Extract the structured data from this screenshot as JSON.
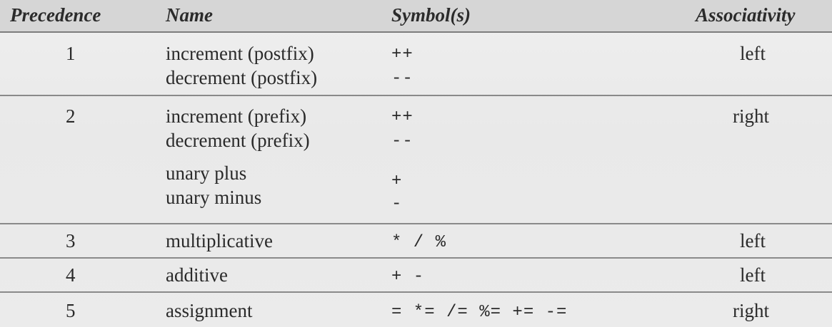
{
  "headers": {
    "precedence": "Precedence",
    "name": "Name",
    "symbols": "Symbol(s)",
    "associativity": "Associativity"
  },
  "groups": [
    {
      "precedence": "1",
      "associativity": "left",
      "rows": [
        {
          "name": "increment (postfix)",
          "symbol": "++"
        },
        {
          "name": "decrement (postfix)",
          "symbol": "--"
        }
      ]
    },
    {
      "precedence": "2",
      "associativity": "right",
      "rows": [
        {
          "name": "increment (prefix)",
          "symbol": "++"
        },
        {
          "name": "decrement (prefix)",
          "symbol": "--"
        },
        {
          "name": "unary plus",
          "symbol": "+"
        },
        {
          "name": "unary minus",
          "symbol": "-"
        }
      ]
    },
    {
      "precedence": "3",
      "associativity": "left",
      "rows": [
        {
          "name": "multiplicative",
          "symbol": "*  /  %"
        }
      ]
    },
    {
      "precedence": "4",
      "associativity": "left",
      "rows": [
        {
          "name": "additive",
          "symbol": "+  -"
        }
      ]
    },
    {
      "precedence": "5",
      "associativity": "right",
      "rows": [
        {
          "name": "assignment",
          "symbol": "=  *=  /=  %=  +=  -="
        }
      ]
    }
  ]
}
